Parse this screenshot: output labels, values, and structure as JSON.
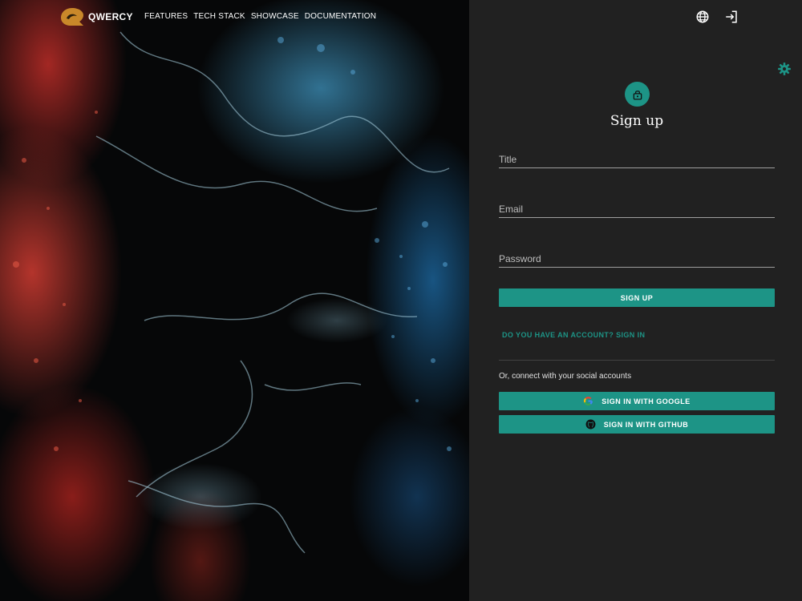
{
  "brand": {
    "name": "QWERCY",
    "logo_icon": "qwercy-logo-icon"
  },
  "nav": {
    "links": [
      "FEATURES",
      "TECH STACK",
      "SHOWCASE",
      "DOCUMENTATION"
    ],
    "language_icon": "globe-icon",
    "login_icon": "login-icon"
  },
  "settings_icon": "gear-icon",
  "signup": {
    "avatar_icon": "lock-icon",
    "title": "Sign up",
    "fields": {
      "title_placeholder": "Title",
      "email_placeholder": "Email",
      "password_placeholder": "Password"
    },
    "submit_label": "SIGN UP",
    "signin_link": "DO YOU HAVE AN ACCOUNT? SIGN IN",
    "social_text": "Or, connect with your social accounts",
    "google_label": "SIGN IN WITH GOOGLE",
    "github_label": "SIGN IN WITH GITHUB"
  },
  "colors": {
    "accent": "#1d9486",
    "panel_background": "#212121",
    "brand_gold": "#c9882a"
  }
}
